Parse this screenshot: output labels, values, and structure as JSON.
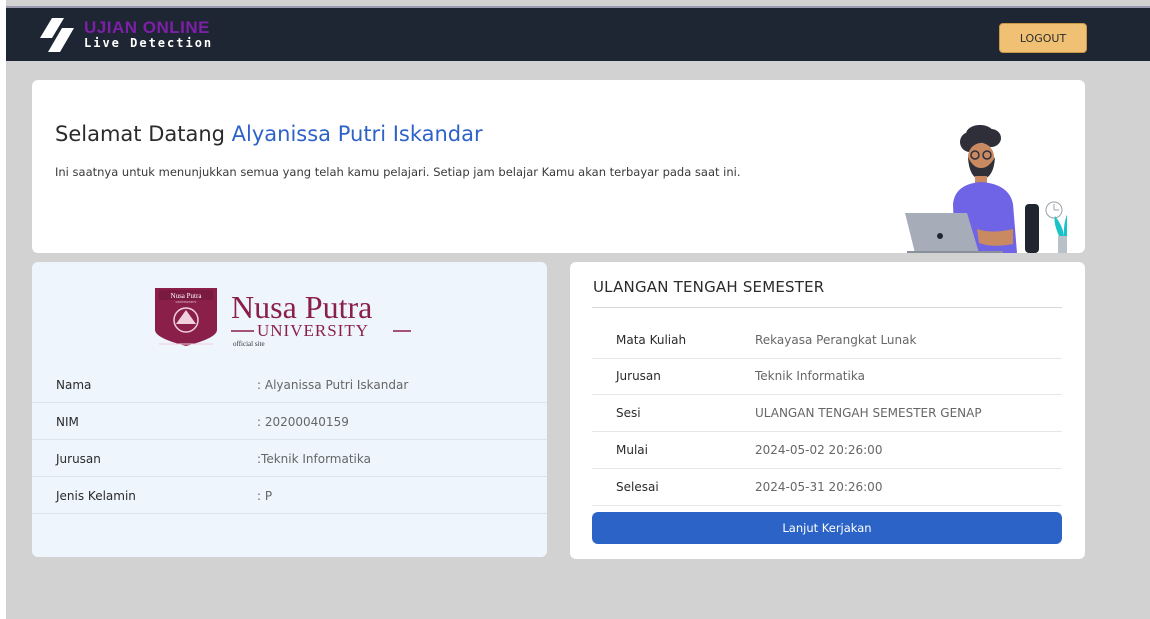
{
  "header": {
    "brand_title": "UJIAN ONLINE",
    "brand_subtitle": "Live Detection",
    "logout_label": "LOGOUT"
  },
  "welcome": {
    "greeting": "Selamat Datang",
    "name": "Alyanissa Putri Iskandar",
    "message": "Ini saatnya untuk menunjukkan semua yang telah kamu pelajari. Setiap jam belajar Kamu akan terbayar pada saat ini."
  },
  "profile": {
    "logo_badge": "Nusa Putra",
    "logo_badge_sub": "UNIVERSITY",
    "logo_title": "Nusa Putra",
    "logo_university": "UNIVERSITY",
    "logo_caption": "official site",
    "rows": [
      {
        "label": "Nama",
        "value": ": Alyanissa Putri Iskandar"
      },
      {
        "label": "NIM",
        "value": ": 20200040159"
      },
      {
        "label": "Jurusan",
        "value": ":Teknik Informatika"
      },
      {
        "label": "Jenis Kelamin",
        "value": ": P"
      }
    ]
  },
  "exam": {
    "title": "ULANGAN TENGAH SEMESTER",
    "rows": [
      {
        "label": "Mata Kuliah",
        "value": "Rekayasa Perangkat Lunak"
      },
      {
        "label": "Jurusan",
        "value": "Teknik Informatika"
      },
      {
        "label": "Sesi",
        "value": "ULANGAN TENGAH SEMESTER GENAP"
      },
      {
        "label": "Mulai",
        "value": "2024-05-02 20:26:00"
      },
      {
        "label": "Selesai",
        "value": "2024-05-31 20:26:00"
      }
    ],
    "button_label": "Lanjut Kerjakan"
  },
  "colors": {
    "navbar": "#1e2533",
    "accent_blue": "#2c63c6",
    "logout_button": "#f0c075",
    "brand_purple": "#7d1fa8",
    "university_maroon": "#8a1f4a"
  },
  "icons": {
    "brand": "diagonal-stripes-logo-icon",
    "illustration": "man-with-laptop-illustration",
    "clock": "clock-icon",
    "plant": "plant-icon",
    "university": "nusa-putra-crest-icon"
  }
}
